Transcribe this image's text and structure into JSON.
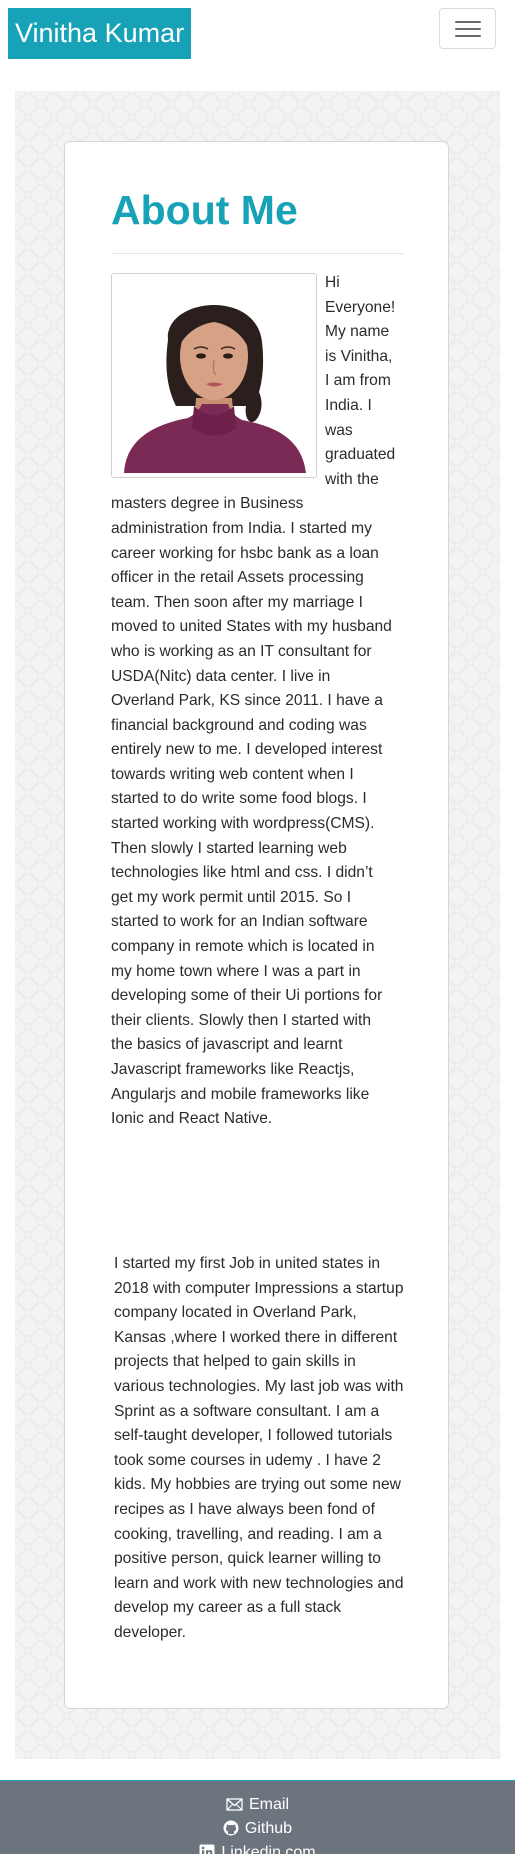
{
  "navbar": {
    "brand": "Vinitha Kumar",
    "toggle_icon": "hamburger-icon"
  },
  "about": {
    "title": "About Me",
    "photo_alt": "Portrait of Vinitha Kumar",
    "paragraph1": "Hi Everyone! My name is Vinitha, I am from India. I was graduated with the masters degree in Business administration from India. I started my career working for hsbc bank as a loan officer in the retail Assets processing team. Then soon after my marriage I moved to united States with my husband who is working as an IT consultant for USDA(Nitc) data center. I live in Overland Park, KS since 2011. I have a financial background and coding was entirely new to me. I developed interest towards writing web content when I started to do write some food blogs. I started working with wordpress(CMS). Then slowly I started learning web technologies like html and css. I didn’t get my work permit until 2015. So I started to work for an Indian software company in remote which is located in my home town where I was a part in developing some of their Ui portions for their clients. Slowly then I started with the basics of javascript and learnt Javascript frameworks like Reactjs, Angularjs and mobile frameworks like Ionic and React Native.",
    "paragraph2": "I started my first Job in united states in 2018 with computer Impressions a startup company located in Overland Park, Kansas ,where I worked there in different projects that helped to gain skills in various technologies. My last job was with Sprint as a software consultant. I am a self-taught developer, I followed tutorials took some courses in udemy . I have 2 kids. My hobbies are trying out some new recipes as I have always been fond of cooking, travelling, and reading. I am a positive person, quick learner willing to learn and work with new technologies and develop my career as a full stack developer."
  },
  "footer": {
    "links": [
      {
        "label": "Email",
        "icon": "envelope-icon"
      },
      {
        "label": "Github",
        "icon": "github-icon"
      },
      {
        "label": "Linkedin.com",
        "icon": "linkedin-icon"
      }
    ]
  },
  "colors": {
    "accent": "#17a2b8",
    "footer_bg": "#6c757d"
  }
}
